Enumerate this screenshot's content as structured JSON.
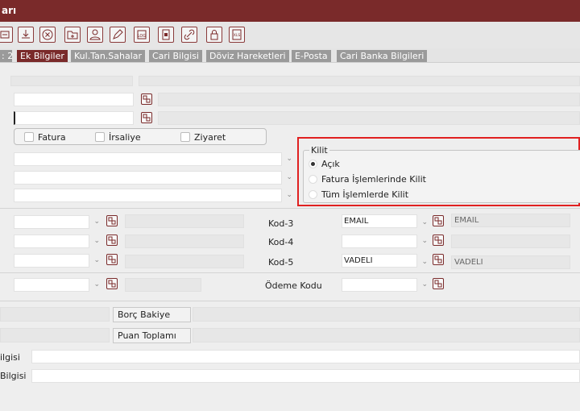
{
  "window": {
    "title": "arı"
  },
  "toolbar": {
    "icons": [
      "list-icon",
      "download-icon",
      "cancel-icon",
      "folder-add-icon",
      "user-icon",
      "edit-icon",
      "log-icon",
      "document-icon",
      "link-icon",
      "lock-icon",
      "xls-icon"
    ]
  },
  "tabs": [
    {
      "label": ": 2",
      "active": false
    },
    {
      "label": "Ek Bilgiler",
      "active": true
    },
    {
      "label": "Kul.Tan.Sahalar",
      "active": false
    },
    {
      "label": "Cari Bilgisi",
      "active": false
    },
    {
      "label": "Döviz Hareketleri",
      "active": false
    },
    {
      "label": "E-Posta",
      "active": false
    },
    {
      "label": "Cari Banka Bilgileri",
      "active": false
    }
  ],
  "checkboxes": [
    {
      "label": "Fatura",
      "checked": false
    },
    {
      "label": "İrsaliye",
      "checked": false
    },
    {
      "label": "Ziyaret",
      "checked": false
    }
  ],
  "kilit": {
    "title": "Kilit",
    "options": [
      {
        "label": "Açık",
        "selected": true
      },
      {
        "label": "Fatura İşlemlerinde Kilit",
        "selected": false
      },
      {
        "label": "Tüm İşlemlerde Kilit",
        "selected": false
      }
    ],
    "highlight_color": "#e02020"
  },
  "codes": {
    "kod3": {
      "label": "Kod-3",
      "value": "EMAIL",
      "description": "EMAIL"
    },
    "kod4": {
      "label": "Kod-4",
      "value": "",
      "description": ""
    },
    "kod5": {
      "label": "Kod-5",
      "value": "VADELI",
      "description": "VADELI"
    },
    "odeme": {
      "label": "Ödeme Kodu",
      "value": ""
    }
  },
  "buttons": {
    "borc_bakiye": "Borç Bakiye",
    "puan_toplami": "Puan Toplamı"
  },
  "bottom_labels": {
    "row1": "ilgisi",
    "row2": "Bilgisi"
  },
  "colors": {
    "brand": "#7a2a2a"
  }
}
